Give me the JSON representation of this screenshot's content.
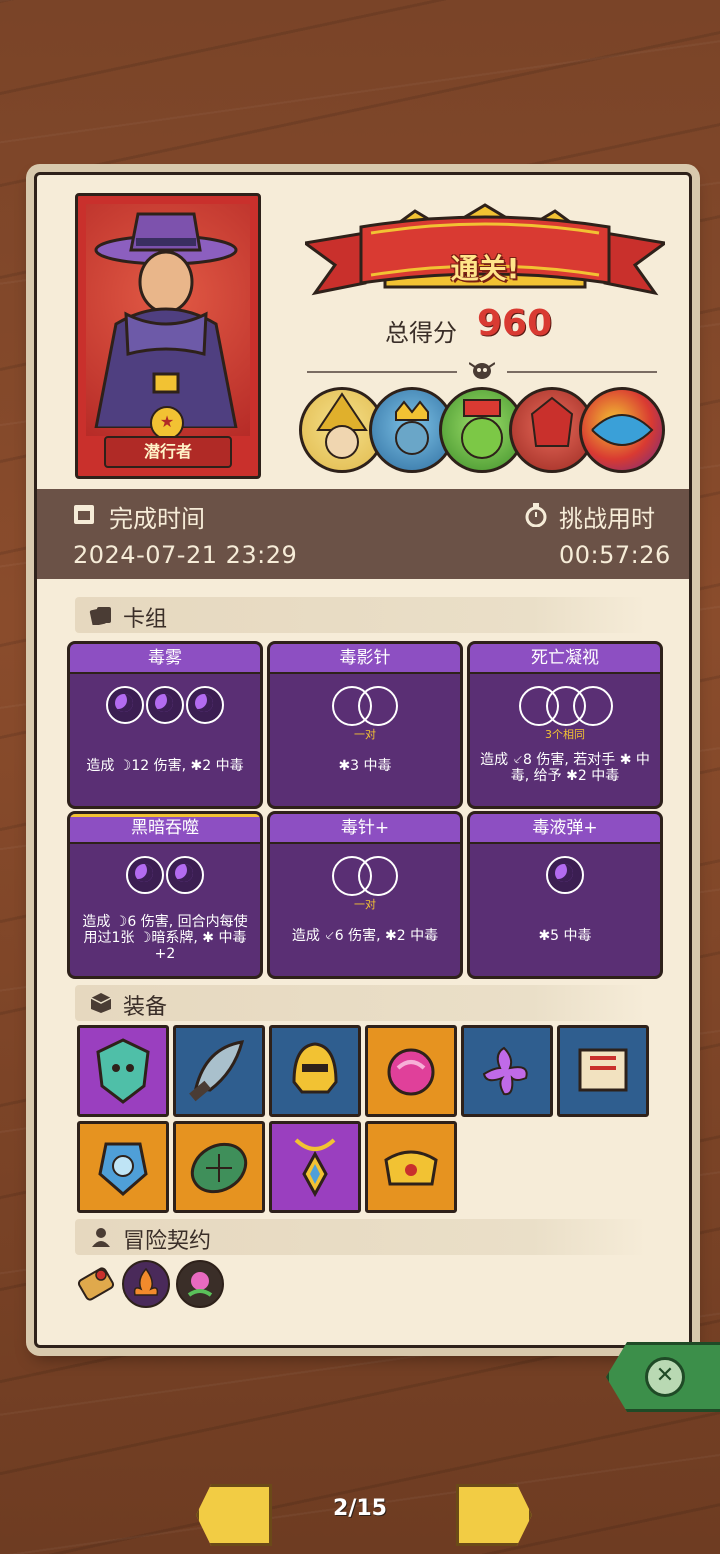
{
  "hero": {
    "name": "潜行者"
  },
  "result": {
    "banner": "通关!",
    "score_label": "总得分",
    "score": "960"
  },
  "time": {
    "finish_label": "完成时间",
    "finish_value": "2024-07-21 23:29",
    "challenge_label": "挑战用时",
    "challenge_value": "00:57:26"
  },
  "deck": {
    "title": "卡组",
    "cards": [
      {
        "name": "毒雾",
        "sub": "",
        "desc": "造成 ☽12 伤害, ✱2 中毒"
      },
      {
        "name": "毒影针",
        "sub": "一对",
        "desc": "✱3 中毒"
      },
      {
        "name": "死亡凝视",
        "sub": "3个相同",
        "desc": "造成 ⸔8 伤害, 若对手 ✱ 中毒, 给予 ✱2 中毒"
      },
      {
        "name": "黑暗吞噬",
        "sub": "",
        "desc": "造成 ☽6 伤害, 回合内每使用过1张 ☽暗系牌, ✱ 中毒+2"
      },
      {
        "name": "毒针+",
        "sub": "一对",
        "desc": "造成 ⸔6 伤害, ✱2 中毒"
      },
      {
        "name": "毒液弹+",
        "sub": "",
        "desc": "✱5 中毒"
      }
    ]
  },
  "equipment": {
    "title": "装备"
  },
  "contracts": {
    "title": "冒险契约"
  },
  "pagination": {
    "indicator": "2/15"
  },
  "colors": {
    "panel": "#f6ecd8",
    "card": "#5a2f74",
    "score": "#d93a32",
    "close": "#3c8f4a"
  }
}
